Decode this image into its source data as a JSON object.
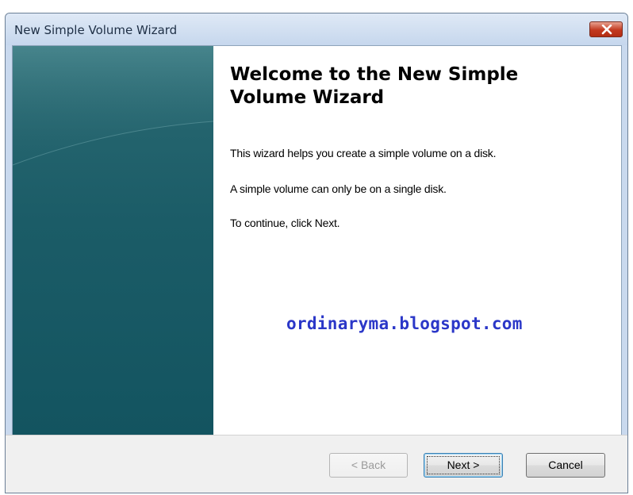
{
  "window": {
    "title": "New Simple Volume Wizard"
  },
  "wizard": {
    "heading": "Welcome to the New Simple Volume Wizard",
    "paragraphs": [
      "This wizard helps you create a simple volume on a disk.",
      "A simple volume can only be on a single disk.",
      "To continue, click Next."
    ],
    "watermark": "ordinaryma.blogspot.com"
  },
  "buttons": {
    "back": "< Back",
    "next": "Next >",
    "cancel": "Cancel"
  },
  "colors": {
    "banner": "#1b5c67",
    "watermark": "#2b37c8",
    "close_button": "#c2391f"
  },
  "icons": {
    "close": "close-icon"
  }
}
